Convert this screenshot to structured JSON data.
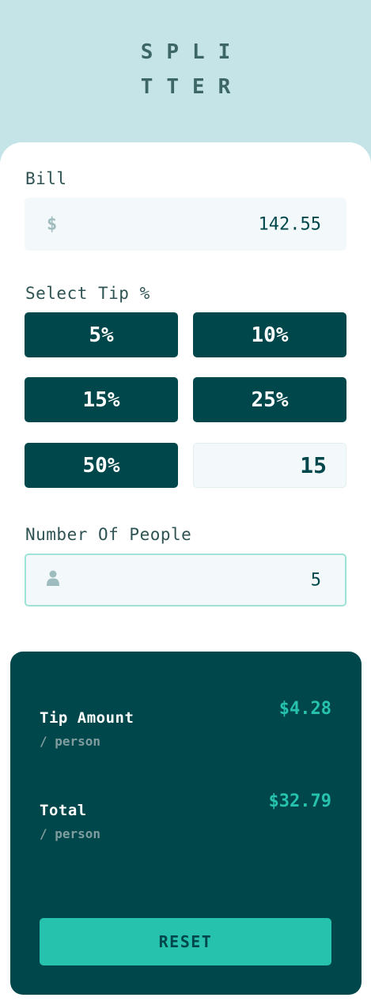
{
  "logo": {
    "line1": "SPLI",
    "line2": "TTER"
  },
  "bill": {
    "label": "Bill",
    "currency_symbol": "$",
    "value": "142.55"
  },
  "tip": {
    "label": "Select Tip %",
    "options": [
      "5%",
      "10%",
      "15%",
      "25%",
      "50%"
    ],
    "custom_value": "15"
  },
  "people": {
    "label": "Number Of People",
    "icon": "person-icon",
    "value": "5"
  },
  "results": {
    "tip_amount": {
      "title": "Tip Amount",
      "sub": "/ person",
      "value": "$4.28"
    },
    "total": {
      "title": "Total",
      "sub": "/ person",
      "value": "$32.79"
    },
    "reset_label": "RESET"
  },
  "colors": {
    "background": "#c5e4e7",
    "primary_dark": "#00474b",
    "accent": "#26c2ad",
    "input_bg": "#f3f9fa"
  }
}
